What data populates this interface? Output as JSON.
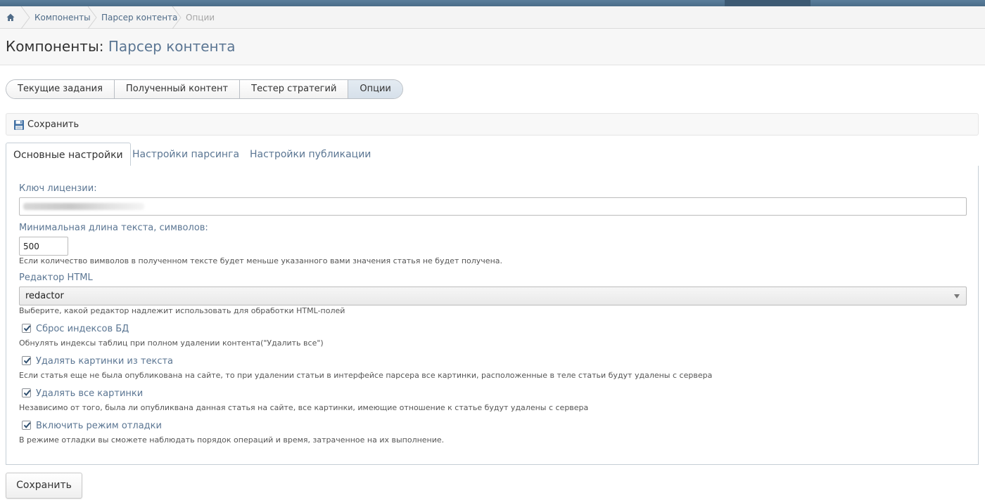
{
  "breadcrumb": {
    "items": [
      {
        "label": "Компоненты"
      },
      {
        "label": "Парсер контента"
      },
      {
        "label": "Опции"
      }
    ]
  },
  "header": {
    "title_prefix": "Компоненты:",
    "title_accent": "Парсер контента"
  },
  "segment_tabs": [
    {
      "label": "Текущие задания"
    },
    {
      "label": "Полученный контент"
    },
    {
      "label": "Тестер стратегий"
    },
    {
      "label": "Опции",
      "active": true
    }
  ],
  "toolbar": {
    "save_label": "Сохранить",
    "save_icon": "floppy-disk-icon"
  },
  "tabs": [
    {
      "label": "Основные настройки",
      "active": true
    },
    {
      "label": "Настройки парсинга"
    },
    {
      "label": "Настройки публикации"
    }
  ],
  "form": {
    "license_label": "Ключ лицензии:",
    "min_length_label": "Минимальная длина текста, символов:",
    "min_length_value": "500",
    "min_length_hint": "Если количество вимволов в полученном тексте будет меньше указанного вами значения статья не будет получена.",
    "editor_label": "Редактор HTML",
    "editor_value": "redactor",
    "editor_hint": "Выберите, какой редактор надлежит использовать для обработки HTML-полей",
    "checkboxes": [
      {
        "label": "Сброс индексов БД",
        "checked": true,
        "hint": "Обнулять индексы таблиц при полном удалении контента(\"Удалить все\")"
      },
      {
        "label": "Удалять картинки из текста",
        "checked": true,
        "hint": "Если статья еще не была опубликована на сайте, то при удалении статьи в интерфейсе парсера все картинки, расположенные в теле статьи будут удалены с сервера"
      },
      {
        "label": "Удалять все картинки",
        "checked": true,
        "hint": "Независимо от того, была ли опубликвана данная статья на сайте, все картинки, имеющие отношение к статье будут удалены с сервера"
      },
      {
        "label": "Включить режим отладки",
        "checked": true,
        "hint": "В режиме отладки вы сможете наблюдать порядок операций и время, затраченное на их выполнение."
      }
    ]
  },
  "footer": {
    "save_label": "Сохранить"
  },
  "colors": {
    "accent": "#5b7693",
    "link": "#4f6b87",
    "topbar": "#4a6c88"
  }
}
